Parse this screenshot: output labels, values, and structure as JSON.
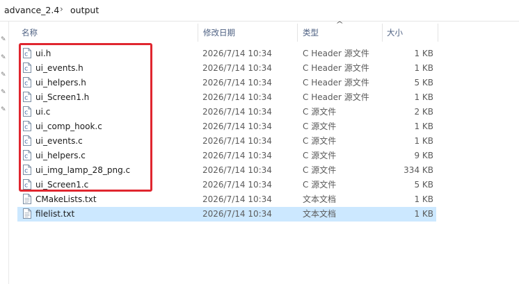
{
  "breadcrumb": {
    "segments": [
      "advance_2.4",
      "output"
    ],
    "separator": "›"
  },
  "columns": {
    "name": "名称",
    "date": "修改日期",
    "type": "类型",
    "size": "大小",
    "sort_indicator": "^"
  },
  "files": [
    {
      "name": "ui.h",
      "date": "2026/7/14 10:34",
      "type": "C Header 源文件",
      "size": "1 KB",
      "icon": "c-source-file-icon"
    },
    {
      "name": "ui_events.h",
      "date": "2026/7/14 10:34",
      "type": "C Header 源文件",
      "size": "1 KB",
      "icon": "c-source-file-icon"
    },
    {
      "name": "ui_helpers.h",
      "date": "2026/7/14 10:34",
      "type": "C Header 源文件",
      "size": "5 KB",
      "icon": "c-source-file-icon"
    },
    {
      "name": "ui_Screen1.h",
      "date": "2026/7/14 10:34",
      "type": "C Header 源文件",
      "size": "1 KB",
      "icon": "c-source-file-icon"
    },
    {
      "name": "ui.c",
      "date": "2026/7/14 10:34",
      "type": "C 源文件",
      "size": "2 KB",
      "icon": "c-source-file-icon"
    },
    {
      "name": "ui_comp_hook.c",
      "date": "2026/7/14 10:34",
      "type": "C 源文件",
      "size": "1 KB",
      "icon": "c-source-file-icon"
    },
    {
      "name": "ui_events.c",
      "date": "2026/7/14 10:34",
      "type": "C 源文件",
      "size": "1 KB",
      "icon": "c-source-file-icon"
    },
    {
      "name": "ui_helpers.c",
      "date": "2026/7/14 10:34",
      "type": "C 源文件",
      "size": "9 KB",
      "icon": "c-source-file-icon"
    },
    {
      "name": "ui_img_lamp_28_png.c",
      "date": "2026/7/14 10:34",
      "type": "C 源文件",
      "size": "334 KB",
      "icon": "c-source-file-icon"
    },
    {
      "name": "ui_Screen1.c",
      "date": "2026/7/14 10:34",
      "type": "C 源文件",
      "size": "5 KB",
      "icon": "c-source-file-icon"
    },
    {
      "name": "CMakeLists.txt",
      "date": "2026/7/14 10:34",
      "type": "文本文档",
      "size": "1 KB",
      "icon": "text-file-icon"
    },
    {
      "name": "filelist.txt",
      "date": "2026/7/14 10:34",
      "type": "文本文档",
      "size": "1 KB",
      "icon": "text-file-icon",
      "selected": true
    }
  ],
  "colors": {
    "selection": "#cce8ff",
    "annotation": "#e0262f",
    "header_text": "#4d6082"
  }
}
